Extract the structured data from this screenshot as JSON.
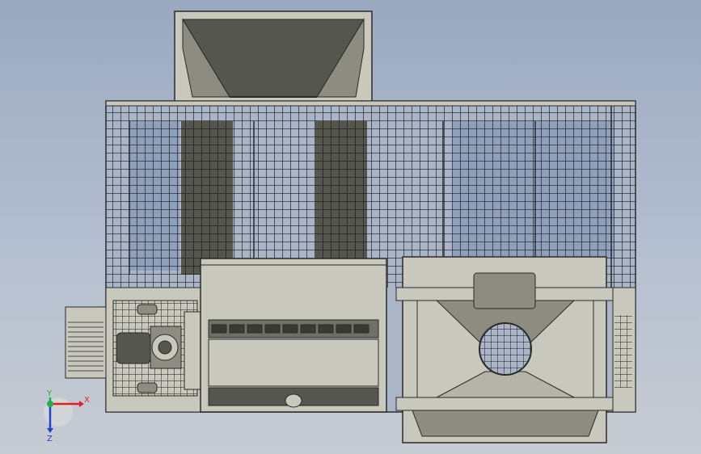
{
  "viewport": {
    "background": "#a7b4c8"
  },
  "triad": {
    "x_label": "X",
    "y_label": "Y",
    "z_label": "Z",
    "x_color": "#e02020",
    "y_color": "#1fb24a",
    "z_color": "#2040d0"
  },
  "colors": {
    "body": "#c8c8bc",
    "edge": "#2a2a2a",
    "mesh": "#1a1a1a",
    "dark": "#55574f",
    "shadow": "#6f7066"
  }
}
